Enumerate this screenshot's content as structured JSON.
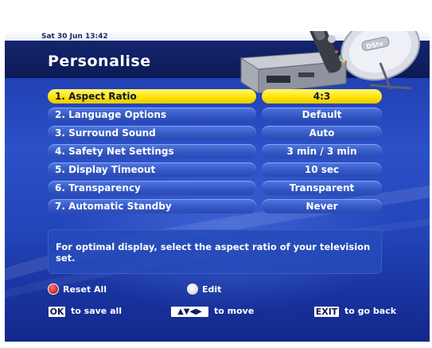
{
  "header": {
    "datetime": "Sat 30 Jun 13:42",
    "title": "Personalise",
    "device_brand": "DStv"
  },
  "menu": {
    "items": [
      {
        "label": "1. Aspect Ratio",
        "value": "4:3"
      },
      {
        "label": "2. Language Options",
        "value": "Default"
      },
      {
        "label": "3. Surround Sound",
        "value": "Auto"
      },
      {
        "label": "4. Safety Net Settings",
        "value": "3 min / 3 min"
      },
      {
        "label": "5. Display Timeout",
        "value": "10 sec"
      },
      {
        "label": "6. Transparency",
        "value": "Transparent"
      },
      {
        "label": "7. Automatic Standby",
        "value": "Never"
      }
    ],
    "selected_index": 0
  },
  "help": {
    "text": "For optimal display, select the aspect ratio of your television set."
  },
  "footer": {
    "reset_all_label": "Reset All",
    "edit_label": "Edit",
    "ok_key": "OK",
    "save_label": "to save all",
    "arrows_key": "▲▼◀▶",
    "move_label": "to move",
    "exit_key": "EXIT",
    "back_label": "to go back"
  },
  "colors": {
    "selected_highlight": "#ffe500",
    "background_blue": "#2c50c8",
    "title_bar": "#0c1a55",
    "red_key": "#c91e1e"
  }
}
